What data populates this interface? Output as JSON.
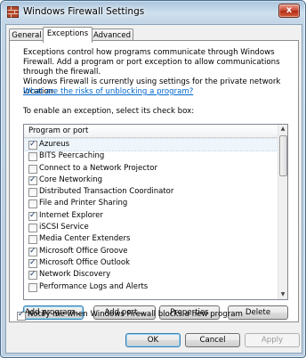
{
  "window": {
    "title": "Windows Firewall Settings",
    "close_glyph": "x"
  },
  "tabs": [
    {
      "label": "General"
    },
    {
      "label": "Exceptions"
    },
    {
      "label": "Advanced"
    }
  ],
  "panel": {
    "intro": "Exceptions control how programs communicate through Windows Firewall. Add a program or port exception to allow communications through the firewall.",
    "status": "Windows Firewall is currently using settings for the private network location.",
    "risk_link": "What are the risks of unblocking a program?",
    "instruction": "To enable an exception, select its check box:"
  },
  "list": {
    "column_header": "Program or port",
    "items": [
      {
        "label": "Azureus",
        "checked": true
      },
      {
        "label": "BITS Peercaching",
        "checked": false
      },
      {
        "label": "Connect to a Network Projector",
        "checked": false
      },
      {
        "label": "Core Networking",
        "checked": true
      },
      {
        "label": "Distributed Transaction Coordinator",
        "checked": false
      },
      {
        "label": "File and Printer Sharing",
        "checked": false
      },
      {
        "label": "Internet Explorer",
        "checked": true
      },
      {
        "label": "iSCSI Service",
        "checked": false
      },
      {
        "label": "Media Center Extenders",
        "checked": false
      },
      {
        "label": "Microsoft Office Groove",
        "checked": true
      },
      {
        "label": "Microsoft Office Outlook",
        "checked": true
      },
      {
        "label": "Network Discovery",
        "checked": true
      },
      {
        "label": "Performance Logs and Alerts",
        "checked": false
      }
    ]
  },
  "actions": {
    "add_program": "Add program...",
    "add_port": "Add port...",
    "properties": "Properties",
    "delete": "Delete"
  },
  "notify": {
    "label": "Notify me when Windows Firewall blocks a new program",
    "checked": true
  },
  "footer": {
    "ok": "OK",
    "cancel": "Cancel",
    "apply": "Apply"
  }
}
